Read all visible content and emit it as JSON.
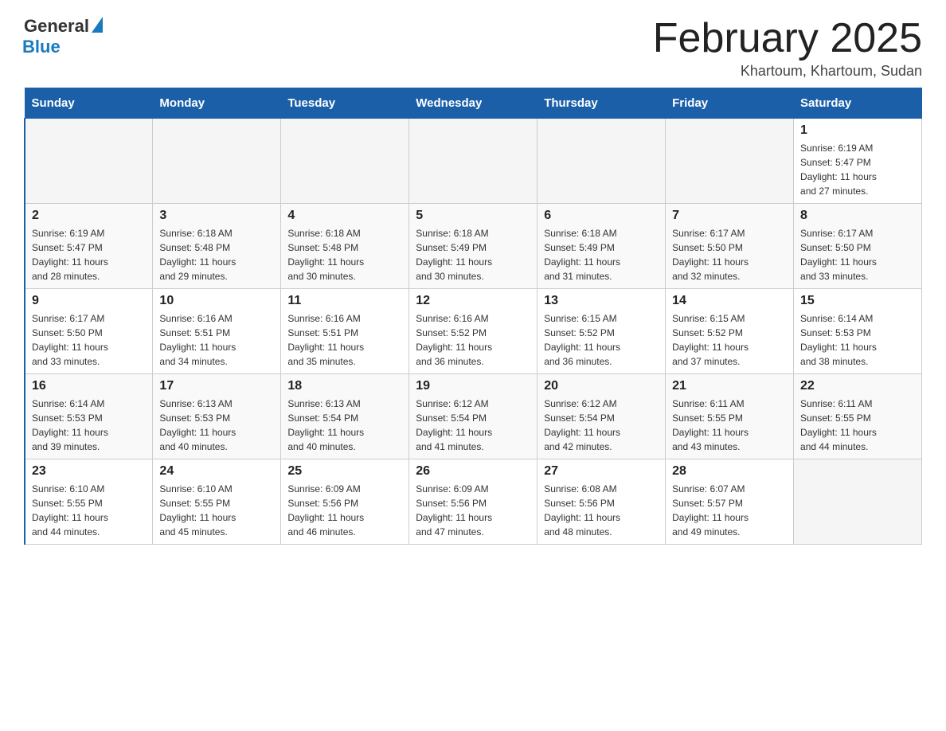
{
  "logo": {
    "general": "General",
    "blue": "Blue"
  },
  "title": "February 2025",
  "location": "Khartoum, Khartoum, Sudan",
  "weekdays": [
    "Sunday",
    "Monday",
    "Tuesday",
    "Wednesday",
    "Thursday",
    "Friday",
    "Saturday"
  ],
  "weeks": [
    [
      {
        "day": "",
        "info": ""
      },
      {
        "day": "",
        "info": ""
      },
      {
        "day": "",
        "info": ""
      },
      {
        "day": "",
        "info": ""
      },
      {
        "day": "",
        "info": ""
      },
      {
        "day": "",
        "info": ""
      },
      {
        "day": "1",
        "info": "Sunrise: 6:19 AM\nSunset: 5:47 PM\nDaylight: 11 hours\nand 27 minutes."
      }
    ],
    [
      {
        "day": "2",
        "info": "Sunrise: 6:19 AM\nSunset: 5:47 PM\nDaylight: 11 hours\nand 28 minutes."
      },
      {
        "day": "3",
        "info": "Sunrise: 6:18 AM\nSunset: 5:48 PM\nDaylight: 11 hours\nand 29 minutes."
      },
      {
        "day": "4",
        "info": "Sunrise: 6:18 AM\nSunset: 5:48 PM\nDaylight: 11 hours\nand 30 minutes."
      },
      {
        "day": "5",
        "info": "Sunrise: 6:18 AM\nSunset: 5:49 PM\nDaylight: 11 hours\nand 30 minutes."
      },
      {
        "day": "6",
        "info": "Sunrise: 6:18 AM\nSunset: 5:49 PM\nDaylight: 11 hours\nand 31 minutes."
      },
      {
        "day": "7",
        "info": "Sunrise: 6:17 AM\nSunset: 5:50 PM\nDaylight: 11 hours\nand 32 minutes."
      },
      {
        "day": "8",
        "info": "Sunrise: 6:17 AM\nSunset: 5:50 PM\nDaylight: 11 hours\nand 33 minutes."
      }
    ],
    [
      {
        "day": "9",
        "info": "Sunrise: 6:17 AM\nSunset: 5:50 PM\nDaylight: 11 hours\nand 33 minutes."
      },
      {
        "day": "10",
        "info": "Sunrise: 6:16 AM\nSunset: 5:51 PM\nDaylight: 11 hours\nand 34 minutes."
      },
      {
        "day": "11",
        "info": "Sunrise: 6:16 AM\nSunset: 5:51 PM\nDaylight: 11 hours\nand 35 minutes."
      },
      {
        "day": "12",
        "info": "Sunrise: 6:16 AM\nSunset: 5:52 PM\nDaylight: 11 hours\nand 36 minutes."
      },
      {
        "day": "13",
        "info": "Sunrise: 6:15 AM\nSunset: 5:52 PM\nDaylight: 11 hours\nand 36 minutes."
      },
      {
        "day": "14",
        "info": "Sunrise: 6:15 AM\nSunset: 5:52 PM\nDaylight: 11 hours\nand 37 minutes."
      },
      {
        "day": "15",
        "info": "Sunrise: 6:14 AM\nSunset: 5:53 PM\nDaylight: 11 hours\nand 38 minutes."
      }
    ],
    [
      {
        "day": "16",
        "info": "Sunrise: 6:14 AM\nSunset: 5:53 PM\nDaylight: 11 hours\nand 39 minutes."
      },
      {
        "day": "17",
        "info": "Sunrise: 6:13 AM\nSunset: 5:53 PM\nDaylight: 11 hours\nand 40 minutes."
      },
      {
        "day": "18",
        "info": "Sunrise: 6:13 AM\nSunset: 5:54 PM\nDaylight: 11 hours\nand 40 minutes."
      },
      {
        "day": "19",
        "info": "Sunrise: 6:12 AM\nSunset: 5:54 PM\nDaylight: 11 hours\nand 41 minutes."
      },
      {
        "day": "20",
        "info": "Sunrise: 6:12 AM\nSunset: 5:54 PM\nDaylight: 11 hours\nand 42 minutes."
      },
      {
        "day": "21",
        "info": "Sunrise: 6:11 AM\nSunset: 5:55 PM\nDaylight: 11 hours\nand 43 minutes."
      },
      {
        "day": "22",
        "info": "Sunrise: 6:11 AM\nSunset: 5:55 PM\nDaylight: 11 hours\nand 44 minutes."
      }
    ],
    [
      {
        "day": "23",
        "info": "Sunrise: 6:10 AM\nSunset: 5:55 PM\nDaylight: 11 hours\nand 44 minutes."
      },
      {
        "day": "24",
        "info": "Sunrise: 6:10 AM\nSunset: 5:55 PM\nDaylight: 11 hours\nand 45 minutes."
      },
      {
        "day": "25",
        "info": "Sunrise: 6:09 AM\nSunset: 5:56 PM\nDaylight: 11 hours\nand 46 minutes."
      },
      {
        "day": "26",
        "info": "Sunrise: 6:09 AM\nSunset: 5:56 PM\nDaylight: 11 hours\nand 47 minutes."
      },
      {
        "day": "27",
        "info": "Sunrise: 6:08 AM\nSunset: 5:56 PM\nDaylight: 11 hours\nand 48 minutes."
      },
      {
        "day": "28",
        "info": "Sunrise: 6:07 AM\nSunset: 5:57 PM\nDaylight: 11 hours\nand 49 minutes."
      },
      {
        "day": "",
        "info": ""
      }
    ]
  ]
}
